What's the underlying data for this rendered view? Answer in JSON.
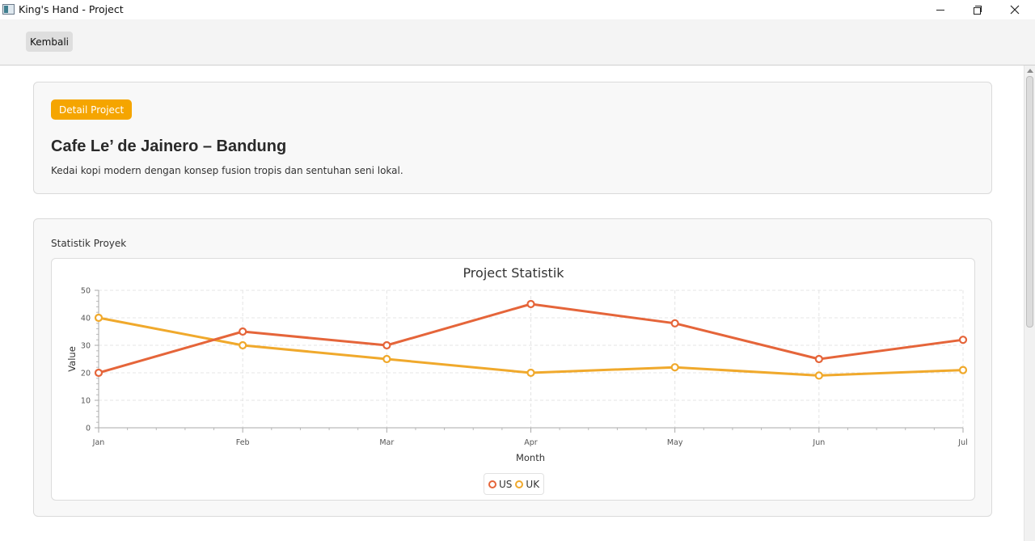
{
  "window": {
    "title": "King's Hand - Project"
  },
  "toolbar": {
    "back_label": "Kembali"
  },
  "detail": {
    "badge": "Detail Project",
    "title": "Cafe Le’ de Jainero – Bandung",
    "description": "Kedai kopi modern dengan konsep fusion tropis dan sentuhan seni lokal."
  },
  "stats": {
    "label": "Statistik Proyek"
  },
  "chart_data": {
    "type": "line",
    "title": "Project Statistik",
    "xlabel": "Month",
    "ylabel": "Value",
    "categories": [
      "Jan",
      "Feb",
      "Mar",
      "Apr",
      "May",
      "Jun",
      "Jul"
    ],
    "ylim": [
      0,
      50
    ],
    "yticks": [
      0,
      10,
      20,
      30,
      40,
      50
    ],
    "grid": true,
    "legend": "bottom-center",
    "series": [
      {
        "name": "US",
        "color": "#e5653a",
        "values": [
          20,
          35,
          30,
          45,
          38,
          25,
          32
        ]
      },
      {
        "name": "UK",
        "color": "#f0a92c",
        "values": [
          40,
          30,
          25,
          20,
          22,
          19,
          21
        ]
      }
    ]
  }
}
